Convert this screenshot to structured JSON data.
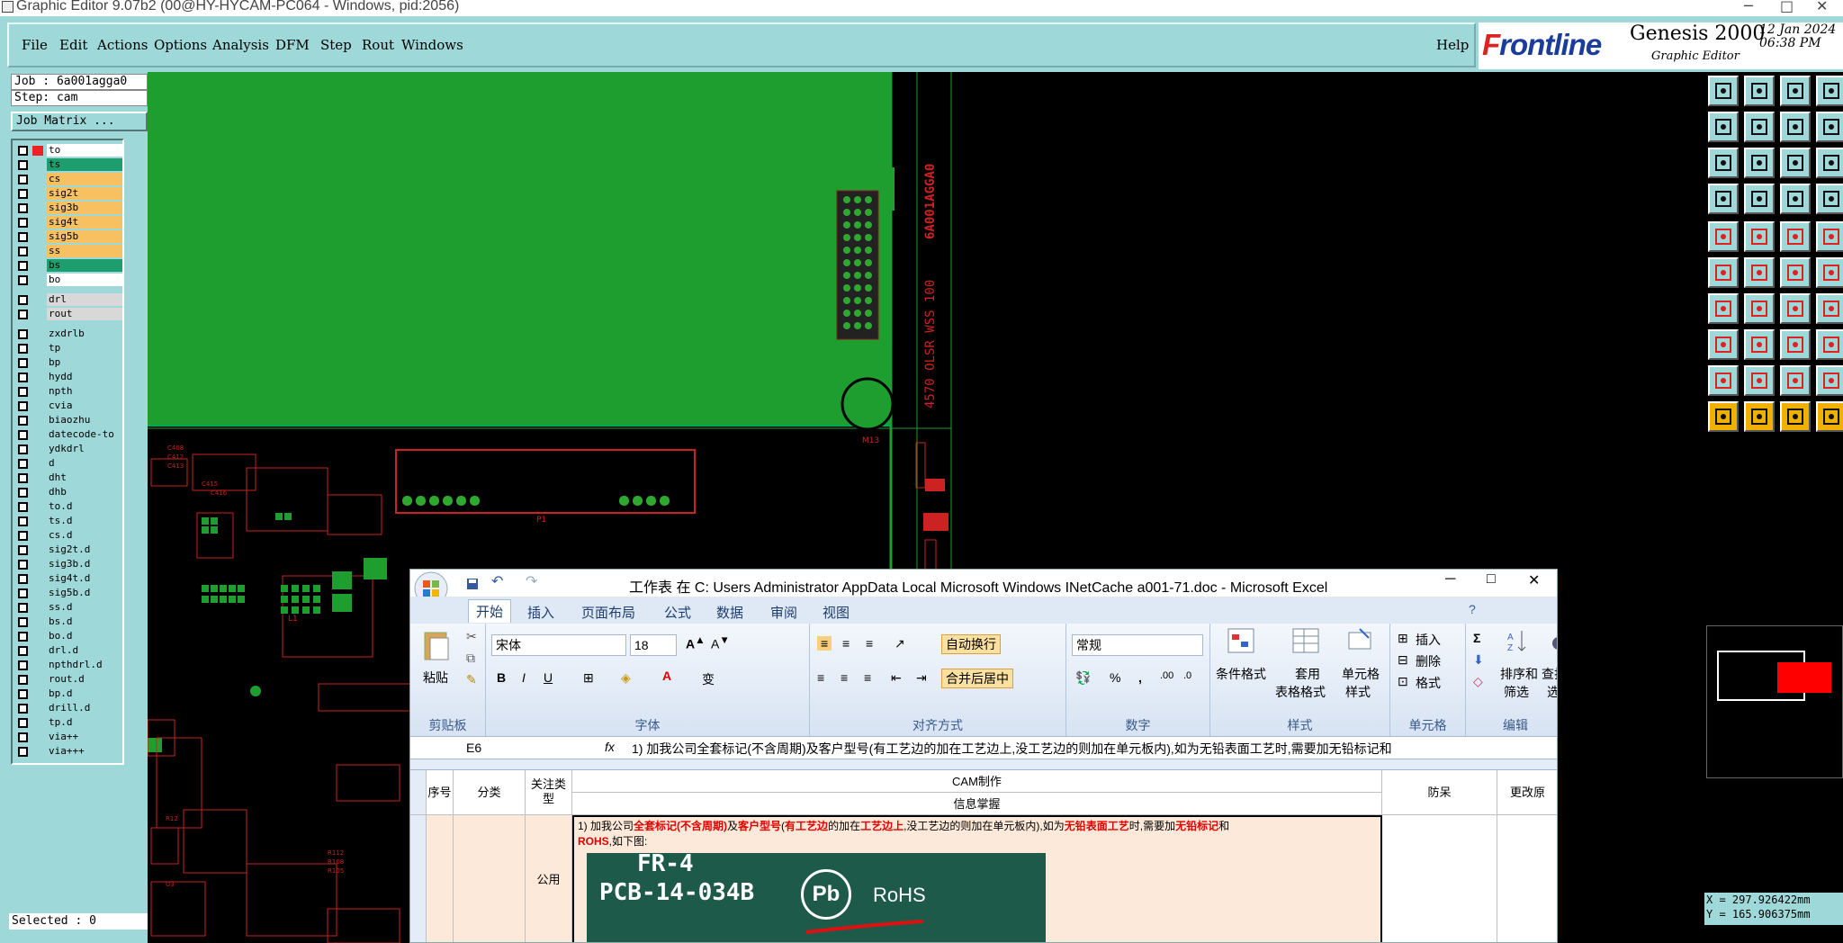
{
  "window": {
    "title": "Graphic Editor 9.07b2 (00@HY-HYCAM-PC064 - Windows, pid:2056)",
    "minimize": "─",
    "maximize": "□",
    "close": "✕"
  },
  "menu": {
    "file": "File",
    "edit": "Edit",
    "actions": "Actions",
    "options": "Options",
    "analysis": "Analysis",
    "dfm": "DFM",
    "step": "Step",
    "rout": "Rout",
    "windows": "Windows",
    "help": "Help"
  },
  "brand": {
    "logo_f": "F",
    "logo_rest": "rontline",
    "product": "Genesis 2000",
    "subtitle": "Graphic Editor",
    "date": "12 Jan 2024",
    "time": "06:38 PM"
  },
  "left_panel": {
    "job": "Job : 6a001agga0",
    "step": "Step: cam",
    "job_matrix": "Job Matrix ...",
    "selected": "Selected : 0"
  },
  "layers": [
    {
      "name": "to",
      "color": "#ffffff"
    },
    {
      "name": "ts",
      "color": "#1e9e6e"
    },
    {
      "name": "cs",
      "color": "#f7c060"
    },
    {
      "name": "sig2t",
      "color": "#f7c060"
    },
    {
      "name": "sig3b",
      "color": "#f7c060"
    },
    {
      "name": "sig4t",
      "color": "#f7c060"
    },
    {
      "name": "sig5b",
      "color": "#f7c060"
    },
    {
      "name": "ss",
      "color": "#f7c060"
    },
    {
      "name": "bs",
      "color": "#1e9e6e"
    },
    {
      "name": "bo",
      "color": "#ffffff"
    },
    {
      "name": "drl",
      "color": "#d8d8d8"
    },
    {
      "name": "rout",
      "color": "#d8d8d8"
    },
    {
      "name": "zxdrlb",
      "color": "#9ed8d8"
    },
    {
      "name": "tp",
      "color": "#9ed8d8"
    },
    {
      "name": "bp",
      "color": "#9ed8d8"
    },
    {
      "name": "hydd",
      "color": "#9ed8d8"
    },
    {
      "name": "npth",
      "color": "#9ed8d8"
    },
    {
      "name": "cvia",
      "color": "#9ed8d8"
    },
    {
      "name": "biaozhu",
      "color": "#9ed8d8"
    },
    {
      "name": "datecode-to",
      "color": "#9ed8d8"
    },
    {
      "name": "ydkdrl",
      "color": "#9ed8d8"
    },
    {
      "name": "d",
      "color": "#9ed8d8"
    },
    {
      "name": "dht",
      "color": "#9ed8d8"
    },
    {
      "name": "dhb",
      "color": "#9ed8d8"
    },
    {
      "name": "to.d",
      "color": "#9ed8d8"
    },
    {
      "name": "ts.d",
      "color": "#9ed8d8"
    },
    {
      "name": "cs.d",
      "color": "#9ed8d8"
    },
    {
      "name": "sig2t.d",
      "color": "#9ed8d8"
    },
    {
      "name": "sig3b.d",
      "color": "#9ed8d8"
    },
    {
      "name": "sig4t.d",
      "color": "#9ed8d8"
    },
    {
      "name": "sig5b.d",
      "color": "#9ed8d8"
    },
    {
      "name": "ss.d",
      "color": "#9ed8d8"
    },
    {
      "name": "bs.d",
      "color": "#9ed8d8"
    },
    {
      "name": "bo.d",
      "color": "#9ed8d8"
    },
    {
      "name": "drl.d",
      "color": "#9ed8d8"
    },
    {
      "name": "npthdrl.d",
      "color": "#9ed8d8"
    },
    {
      "name": "rout.d",
      "color": "#9ed8d8"
    },
    {
      "name": "bp.d",
      "color": "#9ed8d8"
    },
    {
      "name": "drill.d",
      "color": "#9ed8d8"
    },
    {
      "name": "tp.d",
      "color": "#9ed8d8"
    },
    {
      "name": "via++",
      "color": "#9ed8d8"
    },
    {
      "name": "via+++",
      "color": "#9ed8d8"
    }
  ],
  "canvas": {
    "vertical_text_1": "6A001AGGA0",
    "vertical_text_2": "4570 OLSR WSS 100",
    "label_m13": "M13",
    "label_p1": "P1",
    "label_l1": "L1"
  },
  "coords": {
    "x": "X = 297.926422mm",
    "y": "Y = 165.906375mm"
  },
  "excel": {
    "title": "工作表 在 C: Users Administrator AppData Local Microsoft Windows INetCache a001-71.doc - Microsoft Excel",
    "tabs": [
      "开始",
      "插入",
      "页面布局",
      "公式",
      "数据",
      "审阅",
      "视图"
    ],
    "clipboard": {
      "paste": "粘贴",
      "group": "剪贴板"
    },
    "font": {
      "name": "宋体",
      "size": "18",
      "group": "字体",
      "bold": "B",
      "italic": "I",
      "underline": "U"
    },
    "align": {
      "wrap": "自动换行",
      "merge": "合并后居中",
      "group": "对齐方式"
    },
    "number": {
      "format": "常规",
      "percent": "%",
      "comma": ",",
      "group": "数字"
    },
    "styles": {
      "cond": "条件格式",
      "table1": "套用",
      "table2": "表格格式",
      "cell1": "单元格",
      "cell2": "样式",
      "group": "样式"
    },
    "cells": {
      "insert": "插入",
      "delete": "删除",
      "format": "格式",
      "group": "单元格"
    },
    "edit": {
      "sum": "Σ",
      "sort1": "排序和",
      "sort2": "筛选",
      "find1": "查找和",
      "find2": "选择",
      "group": "编辑"
    },
    "name_box": "E6",
    "fx": "fx",
    "formula": "1) 加我公司全套标记(不含周期)及客户型号(有工艺边的加在工艺边上,没工艺边的则加在单元板内),如为无铅表面工艺时,需要加无铅标记和",
    "headers": {
      "seq": "序号",
      "category": "分类",
      "focus": "关注类型",
      "cam": "CAM制作",
      "info": "信息掌握",
      "prevent": "防呆",
      "change": "更改原"
    },
    "row_common": "公用",
    "cell_text_1": "1) 加我公司",
    "cell_text_2": "全套标记(不含周期)",
    "cell_text_3": "及",
    "cell_text_4": "客户型号",
    "cell_text_5": "(",
    "cell_text_6": "有工艺边",
    "cell_text_7": "的加在",
    "cell_text_8": "工艺边上",
    "cell_text_9": ",没工艺边的则加在单元板内),如为",
    "cell_text_10": "无铅表面工艺",
    "cell_text_11": "时,需要加",
    "cell_text_12": "无铅标记",
    "cell_text_13": "和",
    "cell_text_14": "ROHS",
    "cell_text_15": ",如下图:",
    "photo_line1": "FR-4",
    "photo_line2": "PCB-14-034B",
    "photo_pb": "Pb",
    "photo_rohs": "RoHS"
  }
}
